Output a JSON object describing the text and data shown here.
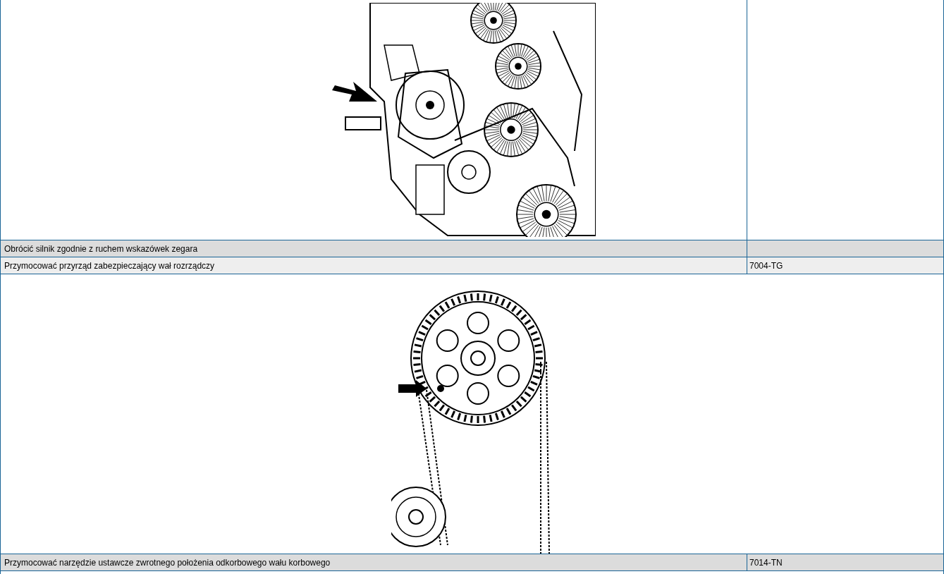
{
  "rows": [
    {
      "kind": "engine-figure"
    },
    {
      "kind": "step",
      "text": "Obrócić silnik zgodnie z ruchem wskazówek zegara",
      "shaded": true
    },
    {
      "kind": "step",
      "text": "Przymocować przyrząd zabezpieczający wał rozrządczy",
      "tool": "7004-TG",
      "shaded": false
    },
    {
      "kind": "sprocket-figure"
    },
    {
      "kind": "step",
      "text": "Przymocować narzędzie ustawcze zwrotnego położenia odkorbowego wału korbowego",
      "tool": "7014-TN",
      "shaded": true
    }
  ]
}
